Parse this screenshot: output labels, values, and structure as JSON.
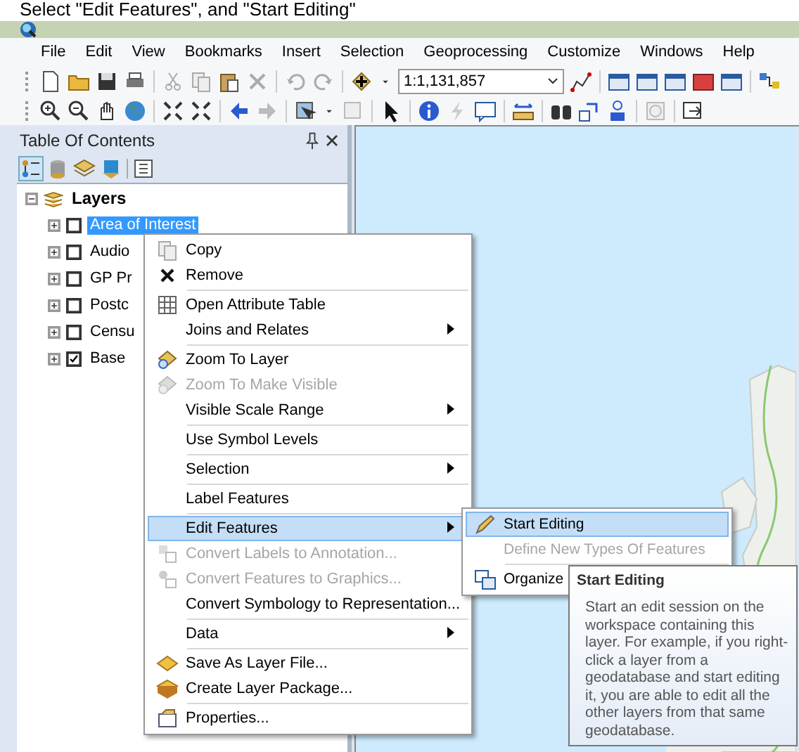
{
  "caption": "Select \"Edit Features\", and \"Start Editing\"",
  "menubar": [
    "File",
    "Edit",
    "View",
    "Bookmarks",
    "Insert",
    "Selection",
    "Geoprocessing",
    "Customize",
    "Windows",
    "Help"
  ],
  "scale_field": {
    "value": "1:1,131,857"
  },
  "toc": {
    "title": "Table Of Contents",
    "root": {
      "label": "Layers",
      "expanded": true,
      "children": [
        {
          "label": "Area of Interest",
          "checked": false,
          "selected": true
        },
        {
          "label": "Audio",
          "checked": false,
          "selected": false
        },
        {
          "label": "GP Pr",
          "checked": false,
          "selected": false
        },
        {
          "label": "Postc",
          "checked": false,
          "selected": false
        },
        {
          "label": "Censu",
          "checked": false,
          "selected": false
        },
        {
          "label": "Base",
          "checked": true,
          "selected": false
        }
      ]
    }
  },
  "context_menu": {
    "groups": [
      [
        {
          "label": "Copy",
          "disabled": false,
          "submenu": false,
          "selected": false
        },
        {
          "label": "Remove",
          "disabled": false,
          "submenu": false,
          "selected": false
        }
      ],
      [
        {
          "label": "Open Attribute Table",
          "disabled": false,
          "submenu": false,
          "selected": false
        },
        {
          "label": "Joins and Relates",
          "disabled": false,
          "submenu": true,
          "selected": false
        }
      ],
      [
        {
          "label": "Zoom To Layer",
          "disabled": false,
          "submenu": false,
          "selected": false
        },
        {
          "label": "Zoom To Make Visible",
          "disabled": true,
          "submenu": false,
          "selected": false
        },
        {
          "label": "Visible Scale Range",
          "disabled": false,
          "submenu": true,
          "selected": false
        }
      ],
      [
        {
          "label": "Use Symbol Levels",
          "disabled": false,
          "submenu": false,
          "selected": false
        }
      ],
      [
        {
          "label": "Selection",
          "disabled": false,
          "submenu": true,
          "selected": false
        }
      ],
      [
        {
          "label": "Label Features",
          "disabled": false,
          "submenu": false,
          "selected": false
        }
      ],
      [
        {
          "label": "Edit Features",
          "disabled": false,
          "submenu": true,
          "selected": true
        },
        {
          "label": "Convert Labels to Annotation...",
          "disabled": true,
          "submenu": false,
          "selected": false
        },
        {
          "label": "Convert Features to Graphics...",
          "disabled": true,
          "submenu": false,
          "selected": false
        },
        {
          "label": "Convert Symbology to Representation...",
          "disabled": false,
          "submenu": false,
          "selected": false
        }
      ],
      [
        {
          "label": "Data",
          "disabled": false,
          "submenu": true,
          "selected": false
        }
      ],
      [
        {
          "label": "Save As Layer File...",
          "disabled": false,
          "submenu": false,
          "selected": false
        },
        {
          "label": "Create Layer Package...",
          "disabled": false,
          "submenu": false,
          "selected": false
        }
      ],
      [
        {
          "label": "Properties...",
          "disabled": false,
          "submenu": false,
          "selected": false
        }
      ]
    ]
  },
  "submenu": {
    "groups": [
      [
        {
          "label": "Start Editing",
          "disabled": false,
          "selected": true
        },
        {
          "label": "Define New Types Of Features",
          "disabled": true,
          "selected": false
        }
      ],
      [
        {
          "label": "Organize",
          "disabled": false,
          "selected": false
        }
      ]
    ]
  },
  "tooltip": {
    "title": "Start Editing",
    "text": "Start an edit session on the workspace containing this layer. For example, if you right-click a layer from a geodatabase and start editing it, you are able to edit all the other layers from that same geodatabase."
  }
}
